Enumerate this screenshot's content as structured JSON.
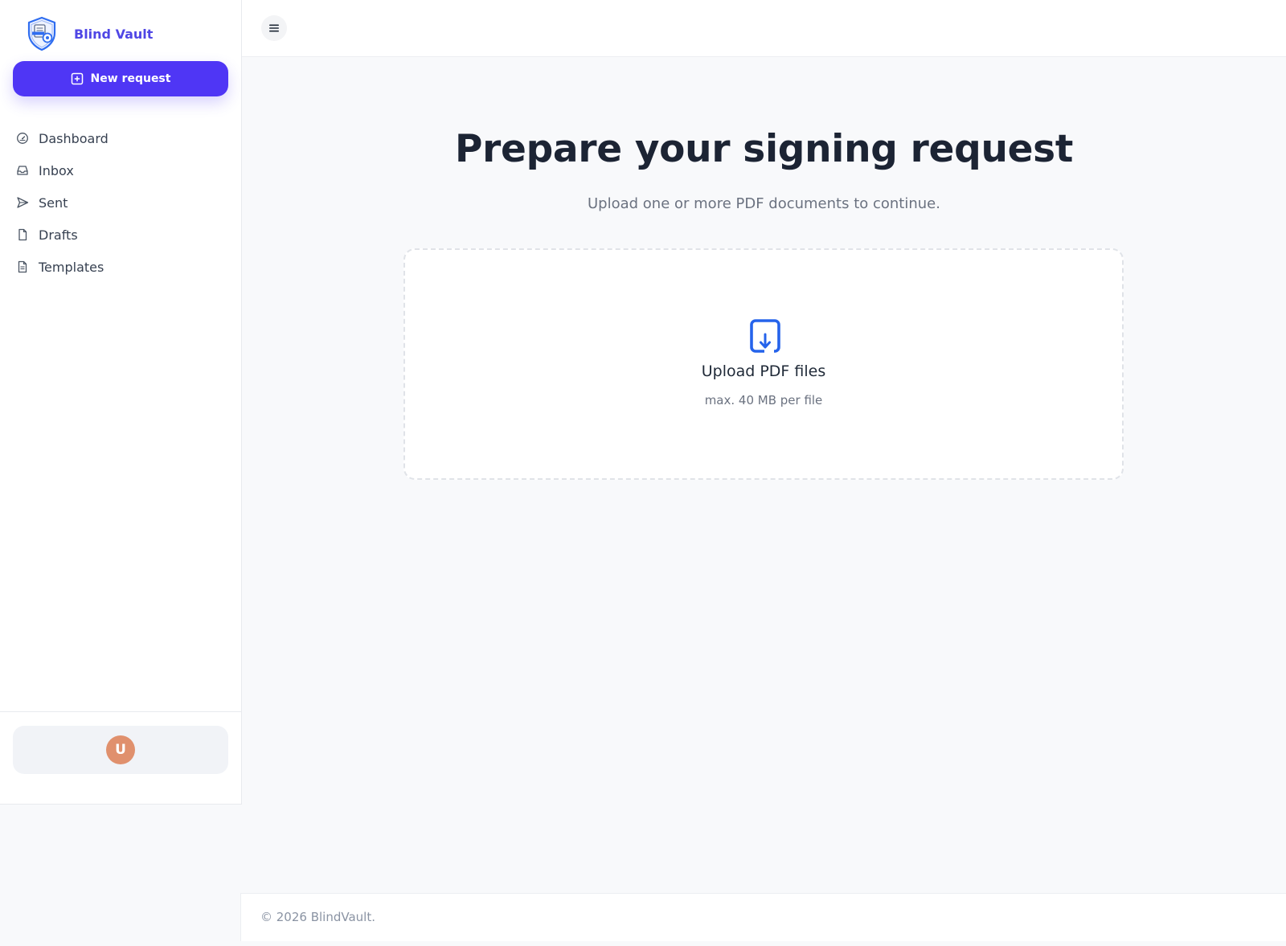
{
  "app": {
    "name": "Blind Vault",
    "logo_icon": "shield-document-icon",
    "accent_color": "#4f36f5"
  },
  "sidebar": {
    "new_request": {
      "label": "New request",
      "icon": "plus-square-icon"
    },
    "items": [
      {
        "label": "Dashboard",
        "icon": "gauge-icon"
      },
      {
        "label": "Inbox",
        "icon": "inbox-icon"
      },
      {
        "label": "Sent",
        "icon": "send-icon"
      },
      {
        "label": "Drafts",
        "icon": "file-icon"
      },
      {
        "label": "Templates",
        "icon": "file-text-icon"
      }
    ],
    "user": {
      "avatar_initial": "U",
      "avatar_color": "#e0906d"
    }
  },
  "topbar": {
    "menu_icon": "hamburger-menu-icon"
  },
  "main": {
    "title": "Prepare your signing request",
    "subtitle": "Upload one or more PDF documents to continue.",
    "dropzone": {
      "icon": "file-download-icon",
      "title": "Upload PDF files",
      "hint": "max. 40 MB per file"
    }
  },
  "footer": {
    "copyright": "© 2026 BlindVault."
  }
}
